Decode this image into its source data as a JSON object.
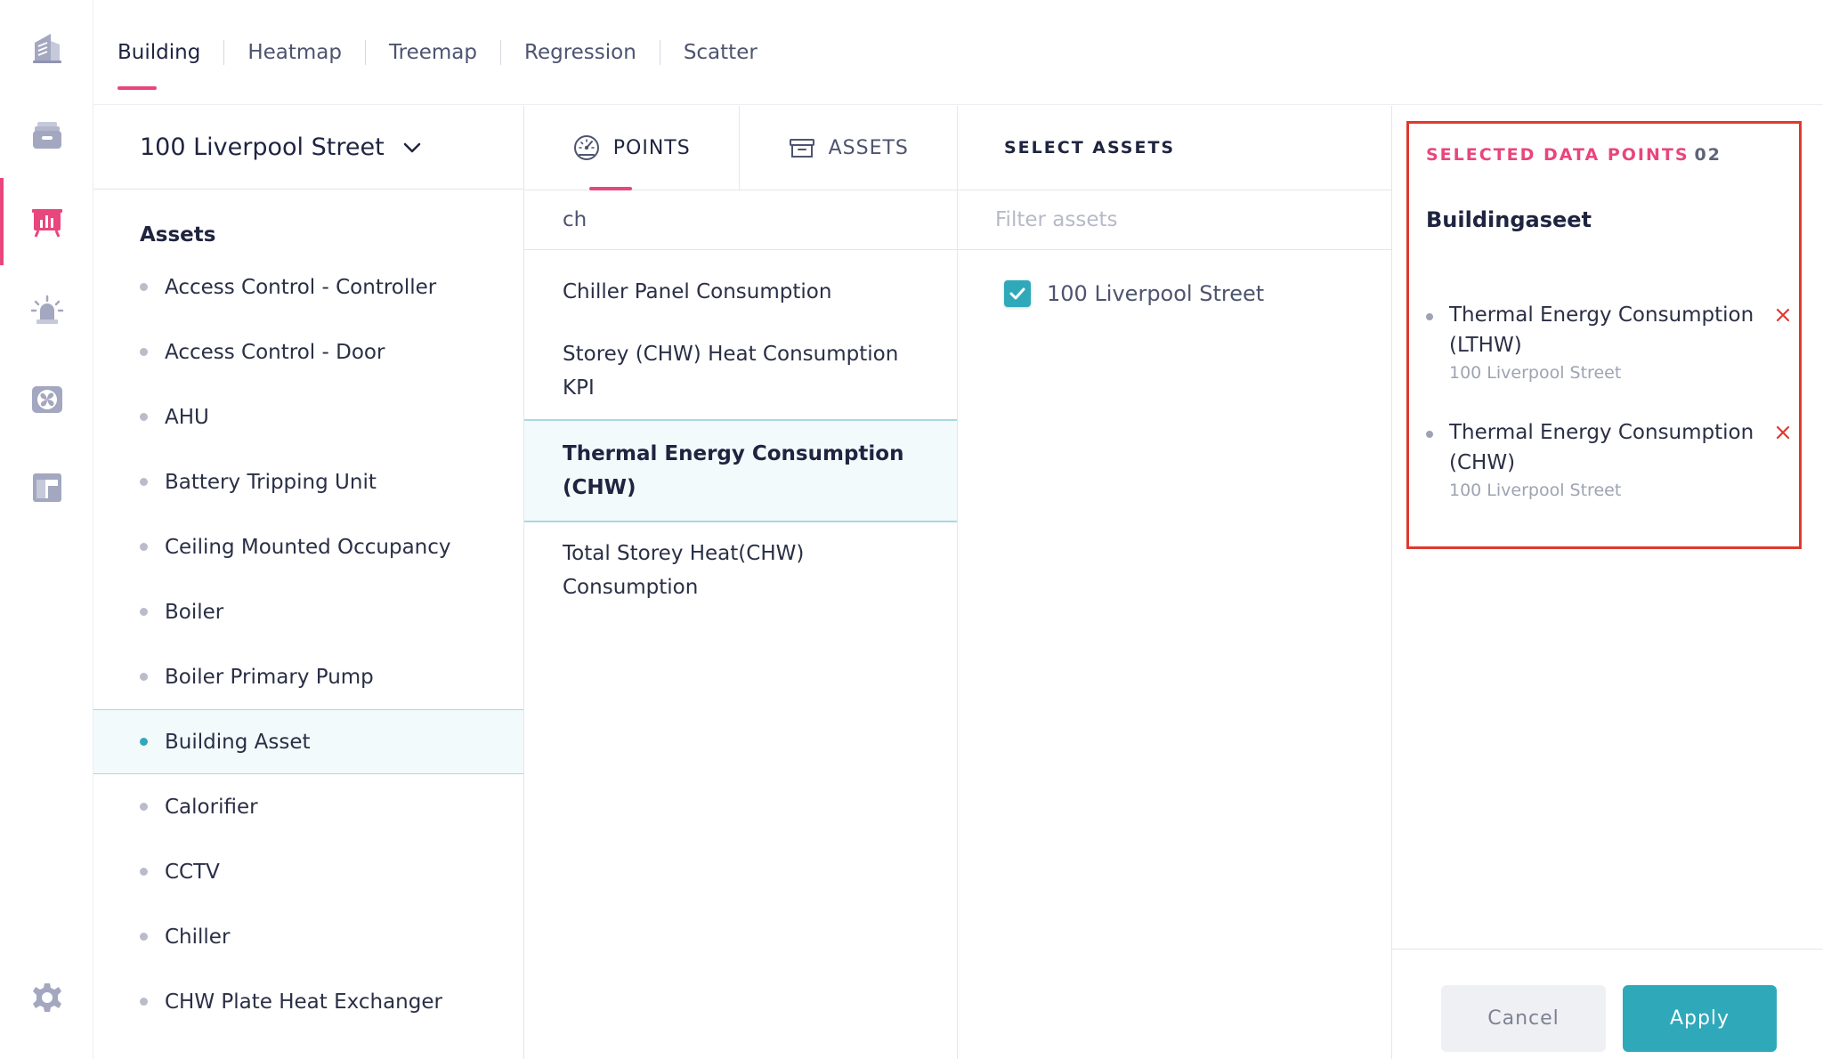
{
  "colors": {
    "accent": "#e8467c",
    "teal": "#2fa9ba",
    "highlight_border": "#e0382e"
  },
  "rail": {
    "items": [
      {
        "name": "building-icon"
      },
      {
        "name": "archive-icon"
      },
      {
        "name": "chart-icon",
        "active": true
      },
      {
        "name": "alarm-icon"
      },
      {
        "name": "fan-icon"
      },
      {
        "name": "floorplan-icon"
      }
    ],
    "settings_icon": "gear-icon"
  },
  "top_tabs": [
    "Building",
    "Heatmap",
    "Treemap",
    "Regression",
    "Scatter"
  ],
  "building_select": {
    "value": "100 Liverpool Street"
  },
  "assets": {
    "heading": "Assets",
    "items": [
      "Access Control - Controller",
      "Access Control - Door",
      "AHU",
      "Battery Tripping Unit",
      "Ceiling Mounted Occupancy",
      "Boiler",
      "Boiler Primary Pump",
      "Building Asset",
      "Calorifier",
      "CCTV",
      "Chiller",
      "CHW Plate Heat Exchanger"
    ],
    "selected": "Building Asset"
  },
  "points_panel": {
    "tab_points": "POINTS",
    "tab_assets": "ASSETS",
    "search_value": "ch",
    "items": [
      "Chiller Panel Consumption",
      "Storey (CHW) Heat Consumption KPI",
      "Thermal Energy Consumption (CHW)",
      "Total Storey Heat(CHW) Consumption"
    ],
    "selected": "Thermal Energy Consumption (CHW)"
  },
  "select_assets": {
    "heading": "SELECT ASSETS",
    "filter_placeholder": "Filter assets",
    "items": [
      {
        "label": "100 Liverpool Street",
        "checked": true
      }
    ]
  },
  "selected_points": {
    "heading": "SELECTED DATA POINTS",
    "count": "02",
    "group": "Buildingaseet",
    "items": [
      {
        "name": "Thermal Energy Consumption (LTHW)",
        "sub": "100 Liverpool Street"
      },
      {
        "name": "Thermal Energy Consumption (CHW)",
        "sub": "100 Liverpool Street"
      }
    ]
  },
  "footer": {
    "cancel_label": "Cancel",
    "apply_label": "Apply"
  }
}
